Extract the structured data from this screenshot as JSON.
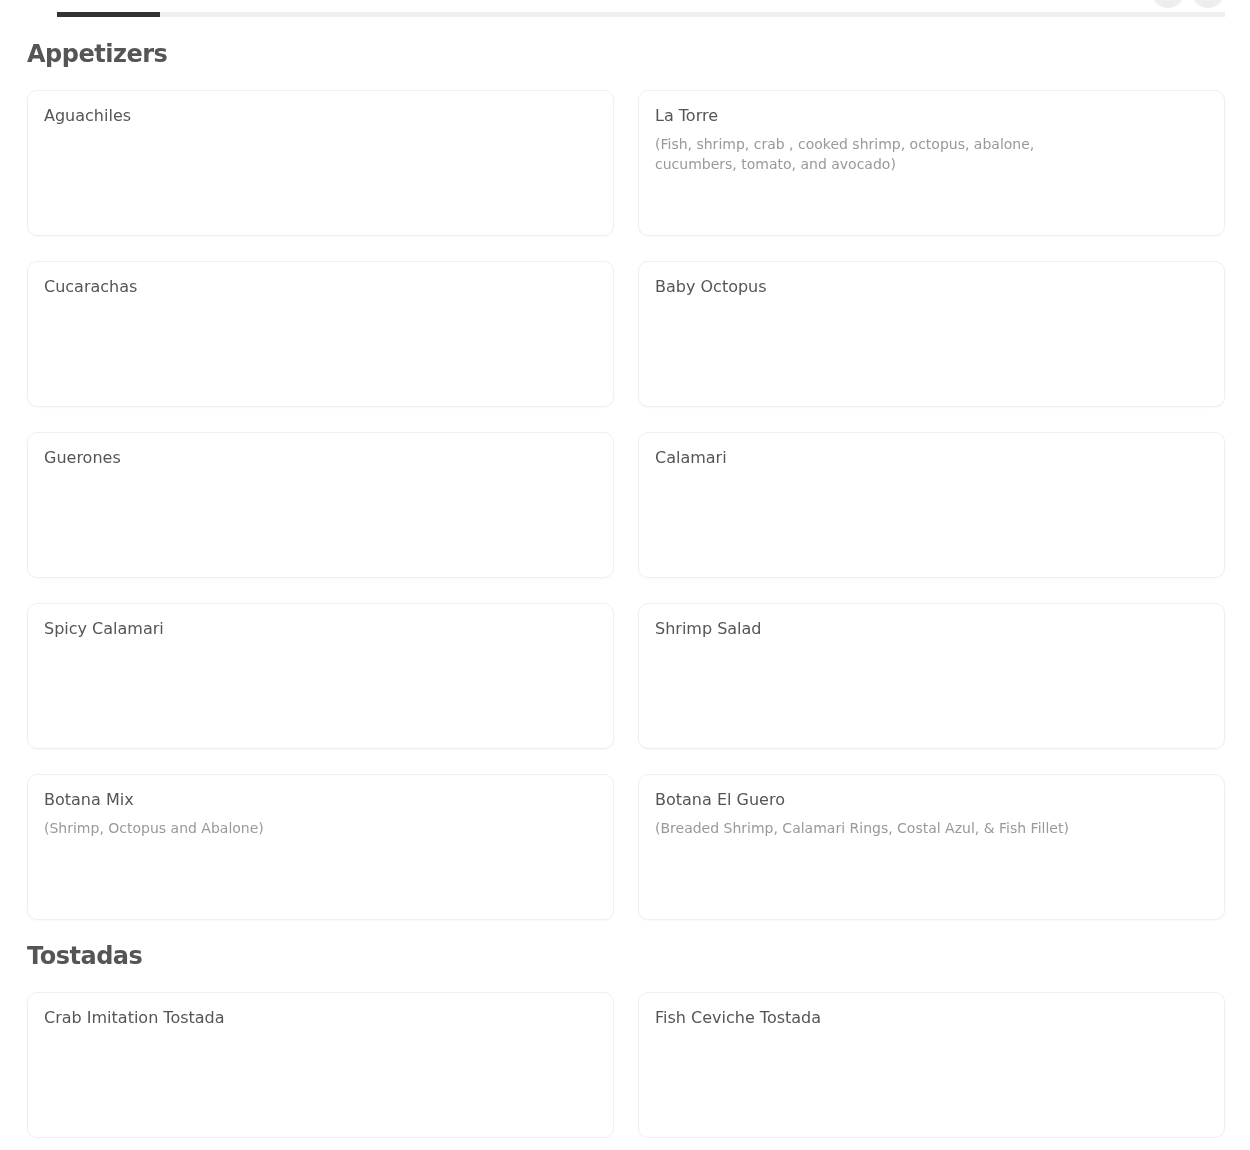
{
  "sections": [
    {
      "title": "Appetizers",
      "items": [
        {
          "name": "Aguachiles"
        },
        {
          "name": "La Torre",
          "description": "(Fish, shrimp, crab , cooked shrimp, octopus, abalone, cucumbers, tomato, and avocado)"
        },
        {
          "name": "Cucarachas"
        },
        {
          "name": "Baby Octopus"
        },
        {
          "name": "Guerones"
        },
        {
          "name": "Calamari"
        },
        {
          "name": "Spicy Calamari"
        },
        {
          "name": "Shrimp Salad"
        },
        {
          "name": "Botana Mix",
          "description": "(Shrimp, Octopus and Abalone)"
        },
        {
          "name": "Botana El Guero",
          "description": "(Breaded Shrimp, Calamari Rings, Costal Azul, & Fish Fillet)"
        }
      ]
    },
    {
      "title": "Tostadas",
      "items": [
        {
          "name": "Crab Imitation Tostada"
        },
        {
          "name": "Fish Ceviche Tostada"
        }
      ]
    }
  ]
}
